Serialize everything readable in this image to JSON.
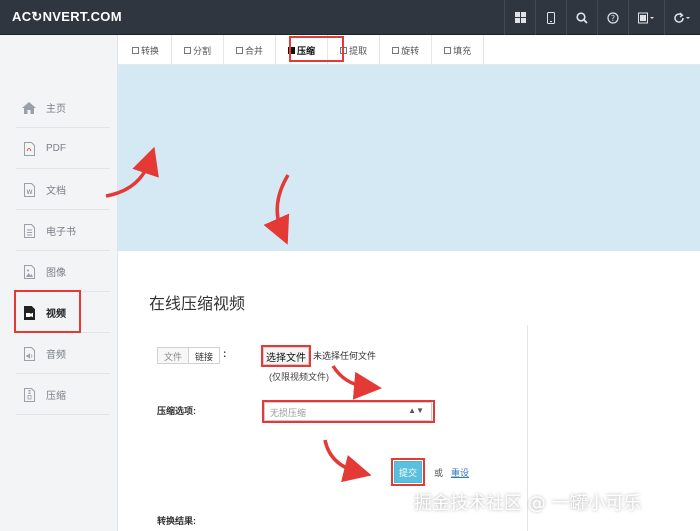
{
  "header": {
    "brand": "AC↻NVERT.COM",
    "icons": [
      "grid-icon",
      "mobile-icon",
      "search-icon",
      "help-icon",
      "language-icon",
      "refresh-icon"
    ]
  },
  "sidebar": {
    "items": [
      {
        "label": "主页",
        "icon": "home-icon",
        "active": false
      },
      {
        "label": "PDF",
        "icon": "pdf-icon",
        "active": false
      },
      {
        "label": "文档",
        "icon": "word-icon",
        "active": false
      },
      {
        "label": "电子书",
        "icon": "ebook-icon",
        "active": false
      },
      {
        "label": "图像",
        "icon": "image-icon",
        "active": false
      },
      {
        "label": "视频",
        "icon": "video-icon",
        "active": true
      },
      {
        "label": "音频",
        "icon": "audio-icon",
        "active": false
      },
      {
        "label": "压缩",
        "icon": "archive-icon",
        "active": false
      }
    ]
  },
  "tabs": [
    {
      "label": "转换",
      "active": false
    },
    {
      "label": "分割",
      "active": false
    },
    {
      "label": "合并",
      "active": false
    },
    {
      "label": "压缩",
      "active": true
    },
    {
      "label": "提取",
      "active": false
    },
    {
      "label": "旋转",
      "active": false
    },
    {
      "label": "填充",
      "active": false
    }
  ],
  "form": {
    "title": "在线压缩视频",
    "source_tab_file": "文件",
    "source_tab_link": "链接",
    "colon": ":",
    "choose_file": "选择文件",
    "no_file": "未选择任何文件",
    "hint": "(仅限视频文件)",
    "option_label": "压缩选项:",
    "option_value": "无损压缩",
    "submit": "提交",
    "or": "或",
    "reset": "重设",
    "result_label": "转换结果:"
  },
  "watermark": "掘金技术社区 @ 一罐小可乐",
  "colors": {
    "accent": "#5bc0de",
    "highlight": "#e53935",
    "navbar": "#2f3640",
    "banner": "#d5e9f4"
  }
}
